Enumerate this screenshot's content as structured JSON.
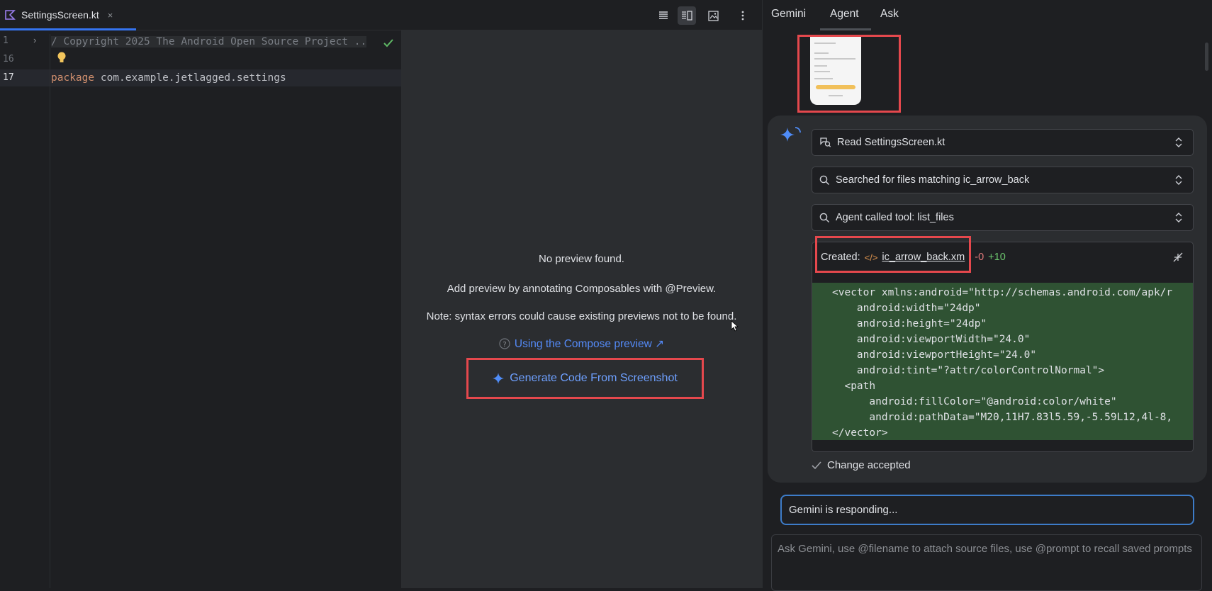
{
  "editor": {
    "tab": {
      "filename": "SettingsScreen.kt",
      "close": "×"
    },
    "toolbar": {
      "icons": [
        "code-only-icon",
        "split-view-icon",
        "design-only-icon",
        "more-vertical-icon"
      ]
    },
    "lines": [
      {
        "number": "1",
        "text": "/ Copyright 2025 The Android Open Source Project .."
      },
      {
        "number": "16",
        "text": ""
      },
      {
        "number": "17",
        "keyword": "package",
        "text": " com.example.jetlagged.settings"
      }
    ]
  },
  "preview": {
    "no_preview": "No preview found.",
    "hint": "Add preview by annotating Composables with @Preview.",
    "note": "Note: syntax errors could cause existing previews not to be found.",
    "compose_link": "Using the Compose preview ↗",
    "generate": "Generate Code From Screenshot"
  },
  "gemini": {
    "tabs": [
      "Gemini",
      "Agent",
      "Ask"
    ],
    "active_tab": "Agent",
    "steps": [
      {
        "icon": "read-file-icon",
        "label": "Read SettingsScreen.kt"
      },
      {
        "icon": "search-icon",
        "label": "Searched for files matching ic_arrow_back"
      },
      {
        "icon": "search-icon",
        "label": "Agent called tool: list_files"
      }
    ],
    "diff": {
      "created_label": "Created:",
      "file": "ic_arrow_back.xml",
      "file_visible": "ic_arrow_back.xm",
      "removed": "-0",
      "added": "+10",
      "code": [
        "<vector xmlns:android=\"http://schemas.android.com/apk/r",
        "    android:width=\"24dp\"",
        "    android:height=\"24dp\"",
        "    android:viewportWidth=\"24.0\"",
        "    android:viewportHeight=\"24.0\"",
        "    android:tint=\"?attr/colorControlNormal\">",
        "  <path",
        "      android:fillColor=\"@android:color/white\"",
        "      android:pathData=\"M20,11H7.83l5.59,-5.59L12,4l-8,",
        "</vector>"
      ]
    },
    "accepted": "Change accepted",
    "responding": "Gemini is responding...",
    "input_placeholder": "Ask Gemini, use @filename to attach source files, use @prompt to recall saved prompts"
  },
  "colors": {
    "highlight_box": "#e5484d",
    "accent": "#3574f0",
    "link": "#548af7",
    "diff_added_bg": "#2f5233",
    "diff_removed": "#e0787a",
    "diff_added": "#6bc46d"
  }
}
